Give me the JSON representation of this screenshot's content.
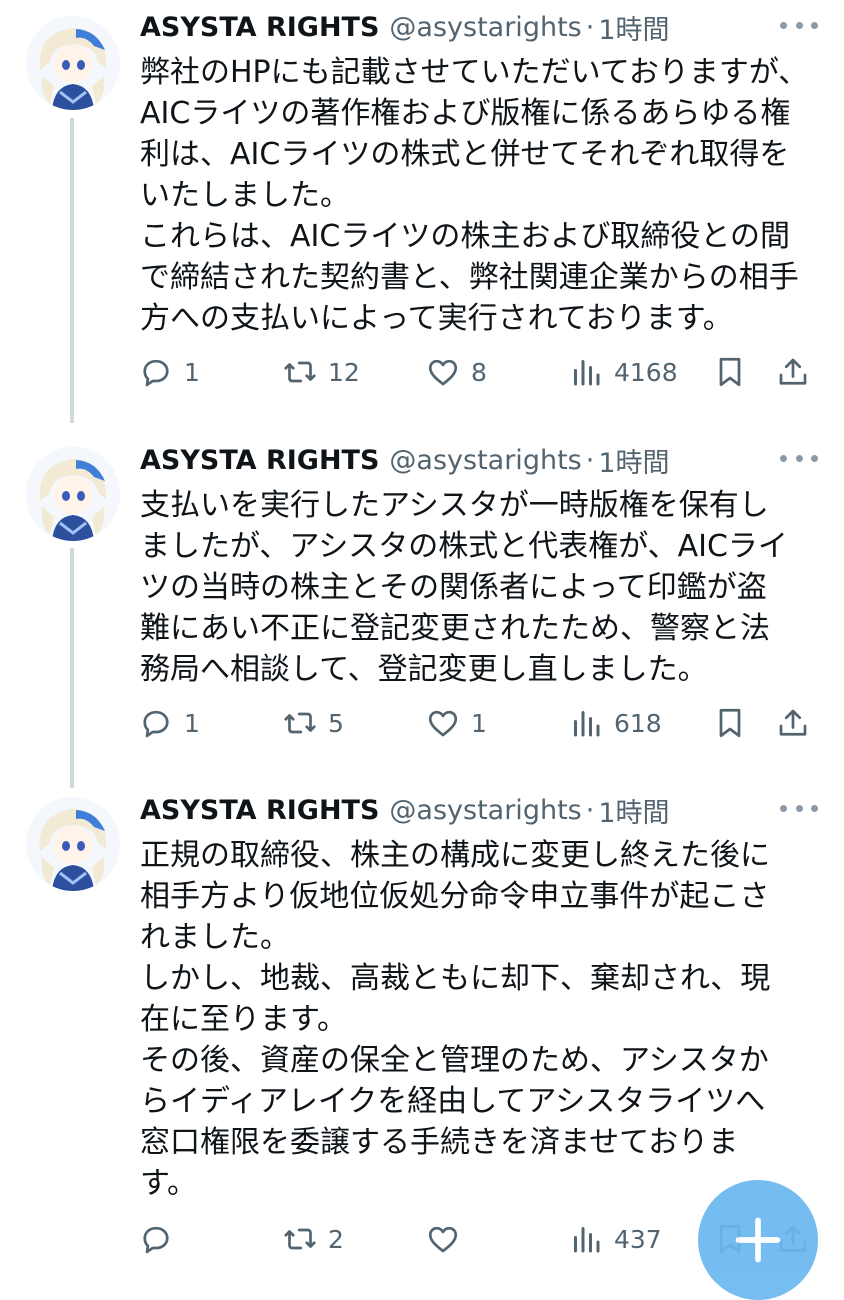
{
  "tweets": [
    {
      "author_name": "ASYSTA RIGHTS",
      "handle": "@asystarights",
      "separator": "·",
      "time": "1時間",
      "lines": [
        "弊社のHPにも記載させていただいておりますが、",
        "AICライツの著作権および版権に係るあらゆる権",
        "利は、AICライツの株式と併せてそれぞれ取得を",
        "いたしました。",
        "これらは、AICライツの株主および取締役との間",
        "で締結された契約書と、弊社関連企業からの相手",
        "方への支払いによって実行されております。"
      ],
      "replies": "1",
      "retweets": "12",
      "likes": "8",
      "views": "4168"
    },
    {
      "author_name": "ASYSTA RIGHTS",
      "handle": "@asystarights",
      "separator": "·",
      "time": "1時間",
      "lines": [
        "支払いを実行したアシスタが一時版権を保有し",
        "ましたが、アシスタの株式と代表権が、AICライ",
        "ツの当時の株主とその関係者によって印鑑が盗",
        "難にあい不正に登記変更されたため、警察と法",
        "務局へ相談して、登記変更し直しました。"
      ],
      "replies": "1",
      "retweets": "5",
      "likes": "1",
      "views": "618"
    },
    {
      "author_name": "ASYSTA RIGHTS",
      "handle": "@asystarights",
      "separator": "·",
      "time": "1時間",
      "lines": [
        "正規の取締役、株主の構成に変更し終えた後に",
        "相手方より仮地位仮処分命令申立事件が起こさ",
        "れました。",
        "しかし、地裁、高裁ともに却下、棄却され、現",
        "在に至ります。",
        "その後、資産の保全と管理のため、アシスタか",
        "らイディアレイクを経由してアシスタライツへ",
        "窓口権限を委譲する手続きを済ませておりま",
        "す。"
      ],
      "replies": "",
      "retweets": "2",
      "likes": "",
      "views": "437"
    }
  ],
  "icons": {
    "reply": "speech-bubble",
    "retweet": "retweet-arrows",
    "like": "heart-outline",
    "views": "bar-chart",
    "bookmark": "bookmark-outline",
    "share": "share-upload",
    "more": "three-dots",
    "fab": "compose-plus"
  },
  "colors": {
    "text": "#0f1419",
    "secondary": "#536471",
    "thread_line": "#cfd9de",
    "fab": "#6ab7f0"
  }
}
